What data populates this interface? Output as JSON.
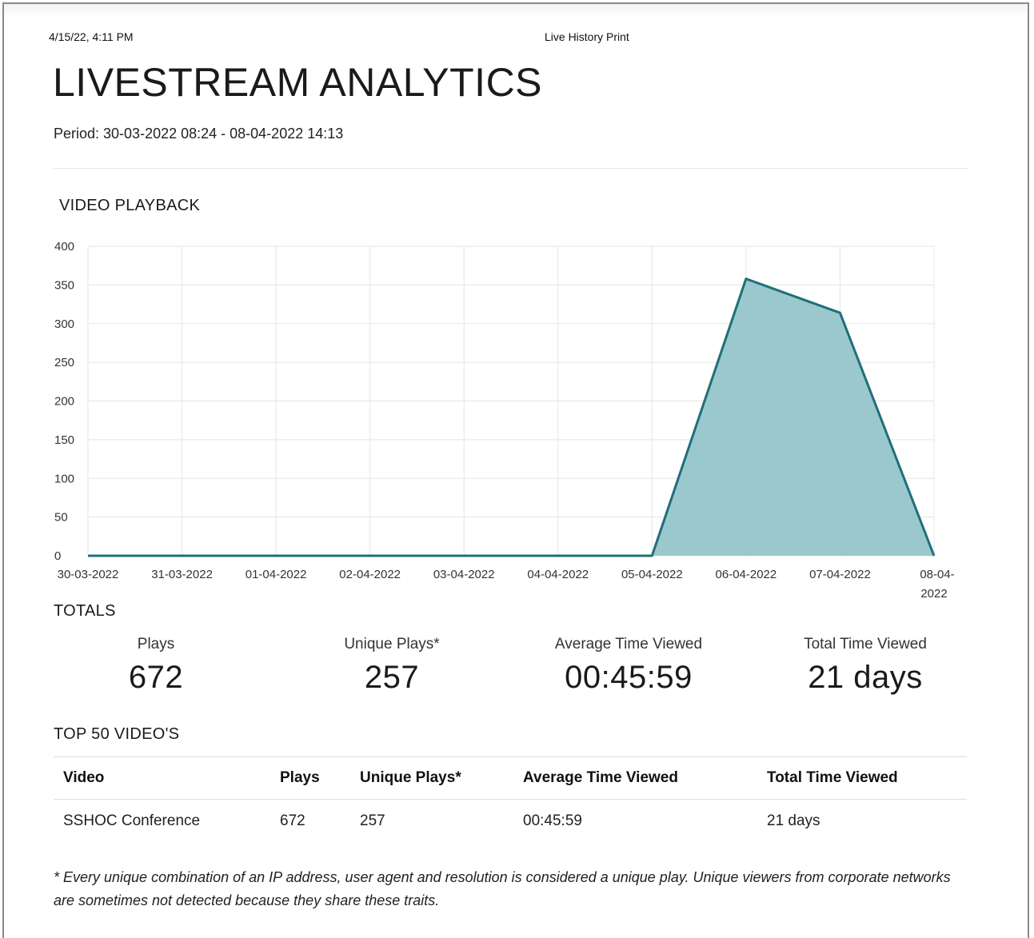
{
  "header": {
    "datetime": "4/15/22, 4:11 PM",
    "print_title": "Live History Print"
  },
  "title": "LIVESTREAM ANALYTICS",
  "period": "Period: 30-03-2022 08:24 - 08-04-2022 14:13",
  "sections": {
    "playback": "VIDEO PLAYBACK",
    "totals": "TOTALS",
    "top": "TOP 50 VIDEO'S"
  },
  "chart_data": {
    "type": "area",
    "title": "VIDEO PLAYBACK",
    "xlabel": "",
    "ylabel": "",
    "categories": [
      "30-03-2022",
      "31-03-2022",
      "01-04-2022",
      "02-04-2022",
      "03-04-2022",
      "04-04-2022",
      "05-04-2022",
      "06-04-2022",
      "07-04-2022",
      "08-04-2022"
    ],
    "values": [
      0,
      0,
      0,
      0,
      0,
      0,
      0,
      358,
      314,
      0
    ],
    "ylim": [
      0,
      400
    ],
    "yticks": [
      0,
      50,
      100,
      150,
      200,
      250,
      300,
      350,
      400
    ],
    "grid": true,
    "colors": {
      "fill": "#8fc2c6",
      "line": "#1f6f78",
      "grid": "#e5e5e5"
    }
  },
  "totals": [
    {
      "label": "Plays",
      "value": "672"
    },
    {
      "label": "Unique Plays*",
      "value": "257"
    },
    {
      "label": "Average Time Viewed",
      "value": "00:45:59"
    },
    {
      "label": "Total Time Viewed",
      "value": "21 days"
    }
  ],
  "table": {
    "headers": [
      "Video",
      "Plays",
      "Unique Plays*",
      "Average Time Viewed",
      "Total Time Viewed"
    ],
    "rows": [
      [
        "SSHOC Conference",
        "672",
        "257",
        "00:45:59",
        "21 days"
      ]
    ]
  },
  "footnote": "* Every unique combination of an IP address, user agent and resolution is considered a unique play. Unique viewers from corporate networks are sometimes not detected because they share these traits."
}
